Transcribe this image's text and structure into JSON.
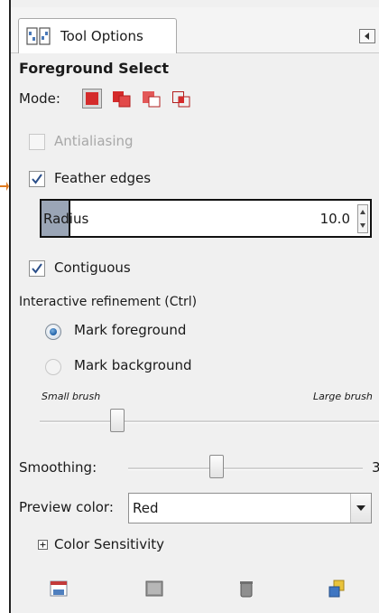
{
  "tab": {
    "label": "Tool Options",
    "icon": "tool-options-icon"
  },
  "tool": {
    "title": "Foreground Select"
  },
  "mode": {
    "label": "Mode:",
    "icons": [
      "mode-replace-icon",
      "mode-add-icon",
      "mode-subtract-icon",
      "mode-intersect-icon"
    ]
  },
  "options": {
    "antialiasing": {
      "label": "Antialiasing",
      "checked": false,
      "disabled": true
    },
    "feather_edges": {
      "label": "Feather edges",
      "checked": true
    },
    "radius": {
      "label": "Radius",
      "value": "10.0"
    },
    "contiguous": {
      "label": "Contiguous",
      "checked": true
    }
  },
  "refinement": {
    "label": "Interactive refinement  (Ctrl)",
    "mark_foreground": "Mark foreground",
    "mark_background": "Mark background",
    "selected": "mark_foreground"
  },
  "brush": {
    "small_label": "Small brush",
    "large_label": "Large brush",
    "level": 0.26
  },
  "smoothing": {
    "label": "Smoothing:",
    "value": "3",
    "level": 0.38
  },
  "preview": {
    "label": "Preview color:",
    "value": "Red"
  },
  "color_sensitivity": {
    "label": "Color Sensitivity",
    "expanded": false
  },
  "bottom_bar": {
    "icons": [
      "save-options-icon",
      "restore-options-icon",
      "delete-options-icon",
      "reset-options-icon"
    ]
  },
  "colors": {
    "accent": "#d42b2b",
    "check": "#2b4f8a",
    "arrow": "#e07a1f"
  }
}
